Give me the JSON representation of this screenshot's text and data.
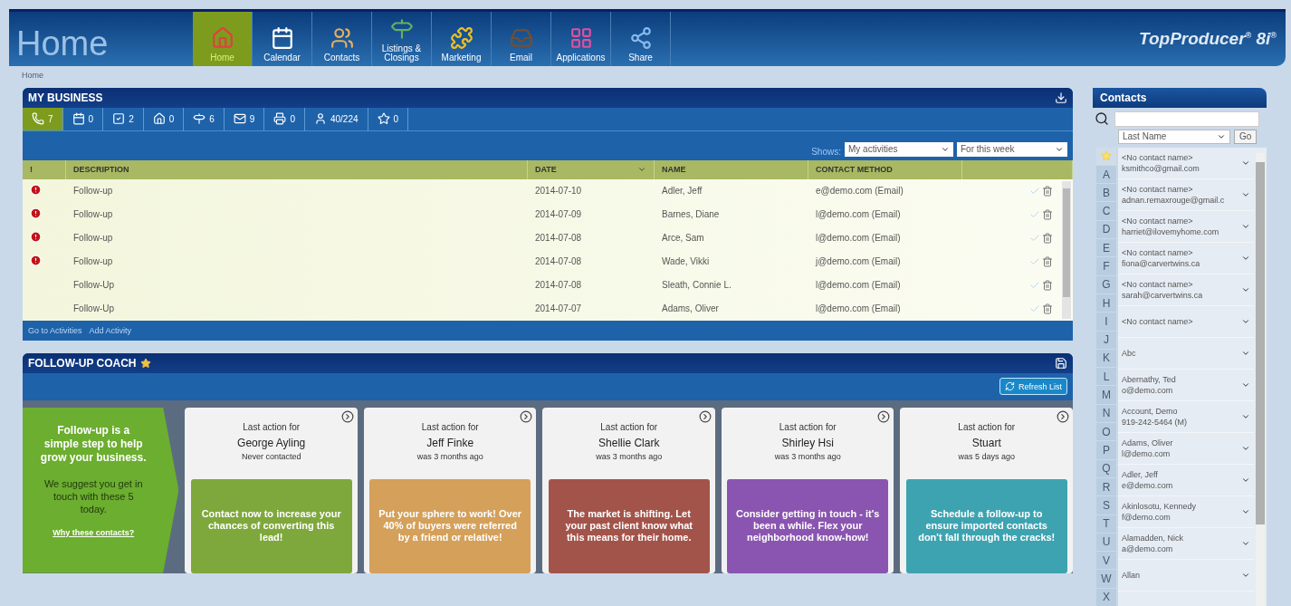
{
  "header": {
    "title": "Home",
    "logo": "TopProducer",
    "logo_mark": "®",
    "version": "8i",
    "version_mark": "®"
  },
  "nav": [
    {
      "label": "Home",
      "selected": true
    },
    {
      "label": "Calendar",
      "selected": false
    },
    {
      "label": "Contacts",
      "selected": false
    },
    {
      "label": "Listings &\nClosings",
      "selected": false
    },
    {
      "label": "Marketing",
      "selected": false
    },
    {
      "label": "Email",
      "selected": false
    },
    {
      "label": "Applications",
      "selected": false
    },
    {
      "label": "Share",
      "selected": false
    }
  ],
  "breadcrumb": "Home",
  "my_business": {
    "title": "MY BUSINESS",
    "stats": [
      {
        "count": "7",
        "selected": true
      },
      {
        "count": "0",
        "selected": false
      },
      {
        "count": "2",
        "selected": false
      },
      {
        "count": "0",
        "selected": false
      },
      {
        "count": "6",
        "selected": false
      },
      {
        "count": "9",
        "selected": false
      },
      {
        "count": "0",
        "selected": false
      },
      {
        "count": "40/224",
        "selected": false
      },
      {
        "count": "0",
        "selected": false
      }
    ],
    "shows_label": "Shows:",
    "filter_owner": "My activities",
    "filter_period": "For this week",
    "columns": [
      {
        "label": "!",
        "sorted": false
      },
      {
        "label": "DESCRIPTION",
        "sorted": false
      },
      {
        "label": "DATE",
        "sorted": true
      },
      {
        "label": "NAME",
        "sorted": false
      },
      {
        "label": "CONTACT METHOD",
        "sorted": false
      }
    ],
    "rows": [
      {
        "urgent": true,
        "description": "Follow-up",
        "date": "2014-07-10",
        "name": "Adler, Jeff",
        "contact": "e@demo.com (Email)"
      },
      {
        "urgent": true,
        "description": "Follow-up",
        "date": "2014-07-09",
        "name": "Barnes, Diane",
        "contact": "l@demo.com (Email)"
      },
      {
        "urgent": true,
        "description": "Follow-up",
        "date": "2014-07-08",
        "name": "Arce, Sam",
        "contact": "l@demo.com (Email)"
      },
      {
        "urgent": true,
        "description": "Follow-up",
        "date": "2014-07-08",
        "name": "Wade, Vikki",
        "contact": "j@demo.com (Email)"
      },
      {
        "urgent": false,
        "description": "Follow-Up",
        "date": "2014-07-08",
        "name": "Sleath, Connie L.",
        "contact": "l@demo.com (Email)"
      },
      {
        "urgent": false,
        "description": "Follow-Up",
        "date": "2014-07-07",
        "name": "Adams, Oliver",
        "contact": "l@demo.com (Email)"
      }
    ],
    "links": [
      "Go to Activities",
      "Add Activity"
    ]
  },
  "coach": {
    "title": "FOLLOW-UP COACH",
    "refresh": "Refresh List",
    "intro": {
      "heading": "Follow-up is a simple step to help grow your business.",
      "text": "We suggest you get in touch with these 5 today.",
      "link": "Why these contacts?"
    },
    "cards": [
      {
        "caption": "Last action for",
        "name": "George Ayling",
        "when": "Never contacted",
        "message": "Contact now to increase your chances of converting this lead!",
        "color": "#7fa83c"
      },
      {
        "caption": "Last action for",
        "name": "Jeff Finke",
        "when": "was 3 months ago",
        "message": "Put your sphere to work! Over 40% of buyers were referred by a friend or relative!",
        "color": "#d4a05a"
      },
      {
        "caption": "Last action for",
        "name": "Shellie Clark",
        "when": "was 3 months ago",
        "message": "The market is shifting. Let your past client know what this means for their home.",
        "color": "#a3544a"
      },
      {
        "caption": "Last action for",
        "name": "Shirley Hsi",
        "when": "was 3 months ago",
        "message": "Consider getting in touch - it's been a while. Flex your neighborhood know-how!",
        "color": "#8a55b0"
      },
      {
        "caption": "Last action for",
        "name": "Stuart",
        "when": "was 5 days ago",
        "message": "Schedule a follow-up to ensure imported contacts don't fall through the cracks!",
        "color": "#3ea3b0"
      }
    ]
  },
  "sidebar": {
    "title": "Contacts",
    "sort": "Last Name",
    "go": "Go",
    "letters": [
      "A",
      "B",
      "C",
      "D",
      "E",
      "F",
      "G",
      "H",
      "I",
      "J",
      "K",
      "L",
      "M",
      "N",
      "O",
      "P",
      "Q",
      "R",
      "S",
      "T",
      "U",
      "V",
      "W",
      "X"
    ],
    "contacts": [
      {
        "name": "<No contact name>",
        "detail": "ksmithco@gmail.com"
      },
      {
        "name": "<No contact name>",
        "detail": "adnan.remaxrouge@gmail.c"
      },
      {
        "name": "<No contact name>",
        "detail": "harriet@ilovemyhome.com"
      },
      {
        "name": "<No contact name>",
        "detail": "fiona@carvertwins.ca"
      },
      {
        "name": "<No contact name>",
        "detail": "sarah@carvertwins.ca"
      },
      {
        "name": "<No contact name>"
      },
      {
        "name": "Abc"
      },
      {
        "name": "Abernathy, Ted",
        "detail": "o@demo.com"
      },
      {
        "name": "Account, Demo",
        "detail": "919-242-5464 (M)"
      },
      {
        "name": "Adams, Oliver",
        "detail": "l@demo.com"
      },
      {
        "name": "Adler, Jeff",
        "detail": "e@demo.com"
      },
      {
        "name": "Akinlosotu, Kennedy",
        "detail": "f@demo.com"
      },
      {
        "name": "Alamadden, Nick",
        "detail": "a@demo.com"
      },
      {
        "name": "Allan"
      }
    ]
  }
}
